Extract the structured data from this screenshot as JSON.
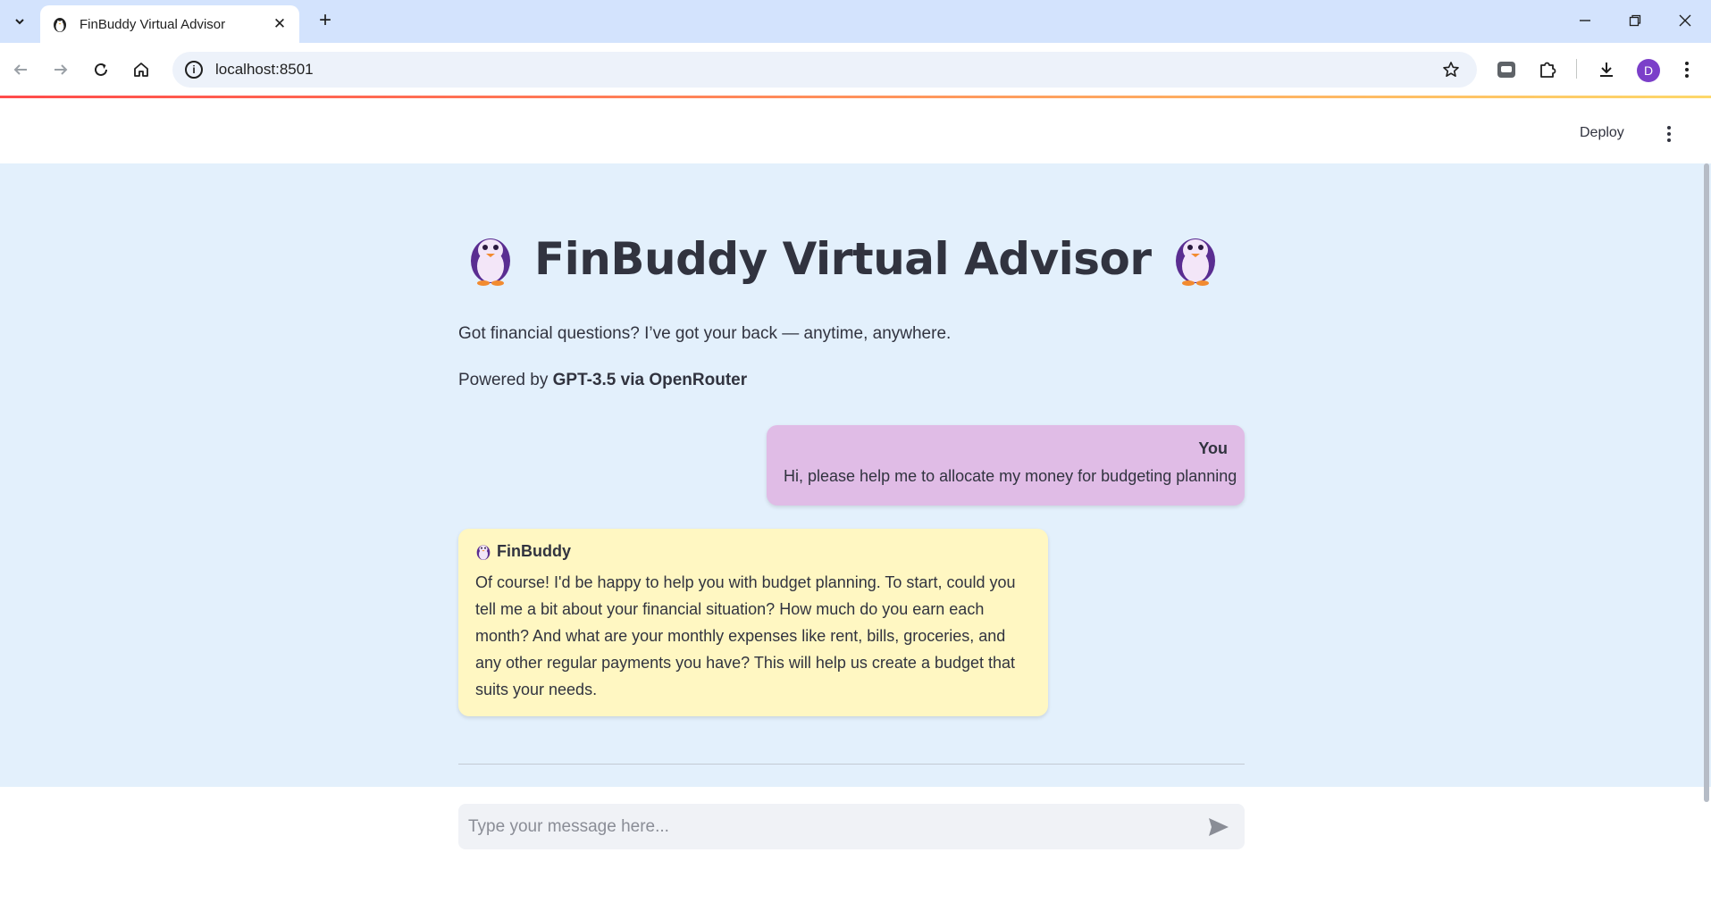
{
  "browser": {
    "tab_title": "FinBuddy Virtual Advisor",
    "url": "localhost:8501",
    "avatar_letter": "D"
  },
  "app_header": {
    "deploy_label": "Deploy"
  },
  "main": {
    "title": "FinBuddy Virtual Advisor",
    "subtitle": "Got financial questions? I’ve got your back — anytime, anywhere.",
    "powered_prefix": "Powered by ",
    "powered_model": "GPT-3.5 via OpenRouter"
  },
  "messages": {
    "user": {
      "sender": "You",
      "text": "Hi, please help me to allocate my money for budgeting planning"
    },
    "bot": {
      "sender": "FinBuddy",
      "text": "Of course! I'd be happy to help you with budget planning. To start, could you tell me a bit about your financial situation? How much do you earn each month? And what are your monthly expenses like rent, bills, groceries, and any other regular payments you have? This will help us create a budget that suits your needs."
    }
  },
  "chat_input": {
    "placeholder": "Type your message here..."
  },
  "colors": {
    "main_bg": "#e3f0fc",
    "user_bubble": "#e0bce6",
    "bot_bubble": "#fff7c2",
    "avatar": "#7b3fc9"
  },
  "icons": {
    "tab_favicon": "penguin-icon",
    "title_decoration": "penguin-icon",
    "send": "send-icon"
  }
}
